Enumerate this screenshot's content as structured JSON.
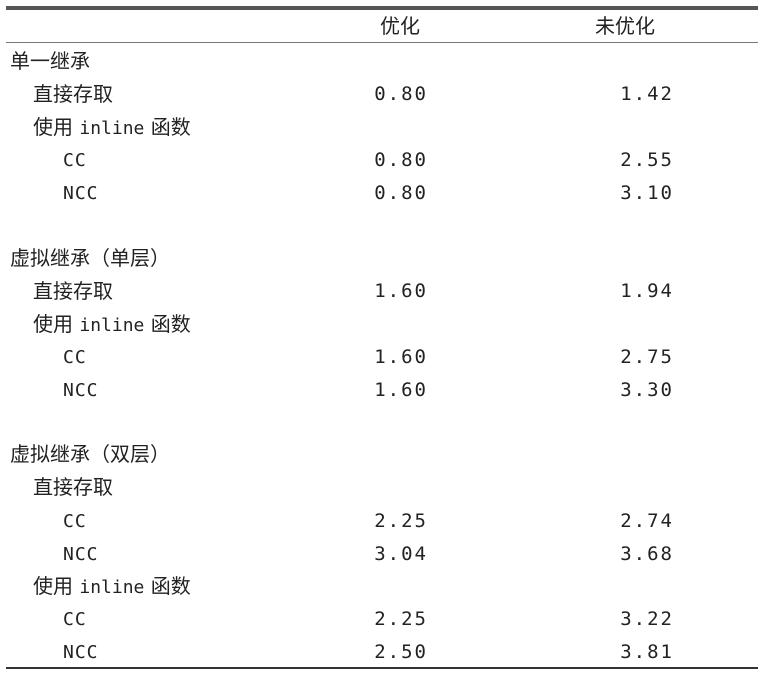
{
  "header": {
    "col_optimized": "优化",
    "col_unoptimized": "未优化"
  },
  "sections": [
    {
      "title": "单一继承",
      "rows": [
        {
          "label": "直接存取",
          "optimized": "0.80",
          "unoptimized": "1.42"
        },
        {
          "label_prefix": "使用 ",
          "label_code": "inline",
          "label_suffix": " 函数"
        },
        {
          "label": "CC",
          "optimized": "0.80",
          "unoptimized": "2.55"
        },
        {
          "label": "NCC",
          "optimized": "0.80",
          "unoptimized": "3.10"
        }
      ]
    },
    {
      "title": "虚拟继承（单层）",
      "rows": [
        {
          "label": "直接存取",
          "optimized": "1.60",
          "unoptimized": "1.94"
        },
        {
          "label_prefix": "使用 ",
          "label_code": "inline",
          "label_suffix": " 函数"
        },
        {
          "label": "CC",
          "optimized": "1.60",
          "unoptimized": "2.75"
        },
        {
          "label": "NCC",
          "optimized": "1.60",
          "unoptimized": "3.30"
        }
      ]
    },
    {
      "title": "虚拟继承（双层）",
      "rows": [
        {
          "label": "直接存取"
        },
        {
          "label": "CC",
          "optimized": "2.25",
          "unoptimized": "2.74"
        },
        {
          "label": "NCC",
          "optimized": "3.04",
          "unoptimized": "3.68"
        },
        {
          "label_prefix": "使用 ",
          "label_code": "inline",
          "label_suffix": " 函数"
        },
        {
          "label": "CC",
          "optimized": "2.25",
          "unoptimized": "3.22"
        },
        {
          "label": "NCC",
          "optimized": "2.50",
          "unoptimized": "3.81"
        }
      ]
    }
  ]
}
